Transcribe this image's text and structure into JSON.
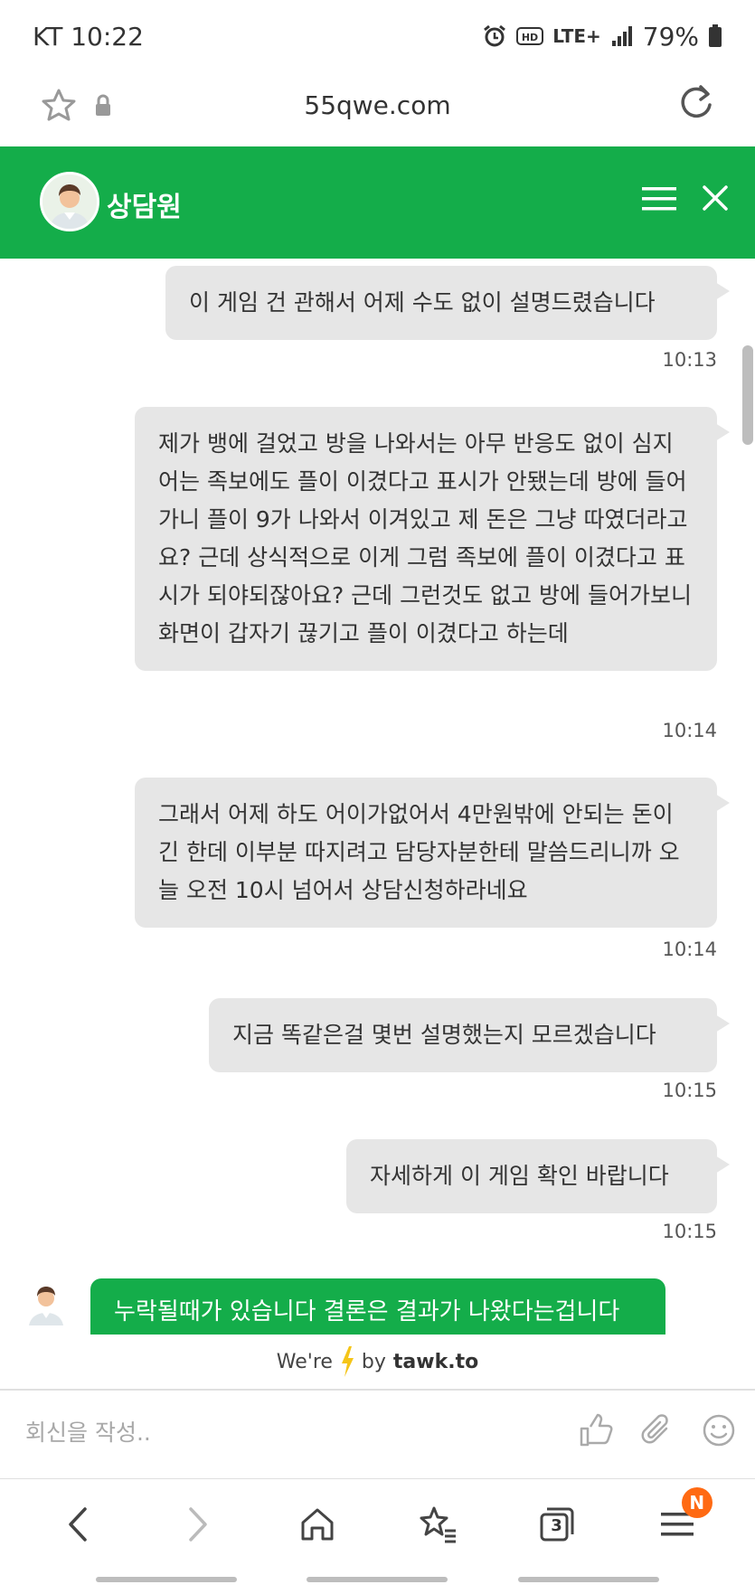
{
  "status": {
    "carrier_time": "KT 10:22",
    "network": "LTE+",
    "battery": "79%"
  },
  "browser": {
    "url": "55qwe.com"
  },
  "chat": {
    "agent_name": "상담원",
    "messages": [
      {
        "text": "이 게임 건 관해서 어제 수도 없이 설명드렸습니다",
        "time": "10:13"
      },
      {
        "text": "제가 뱅에 걸었고 방을 나와서는 아무 반응도 없이 심지어는 족보에도 플이 이겼다고 표시가 안됐는데 방에 들어가니 플이 9가 나와서 이겨있고 제 돈은 그냥 따였더라고요? 근데 상식적으로 이게 그럼 족보에 플이 이겼다고 표시가 되야되잖아요? 근데 그런것도 없고 방에 들어가보니 화면이 갑자기 끊기고 플이 이겼다고 하는데",
        "time": "10:14"
      },
      {
        "text": "그래서 어제 하도 어이가없어서 4만원밖에 안되는 돈이긴 한데 이부분 따지려고 담당자분한테 말씀드리니까 오늘 오전 10시 넘어서 상담신청하라네요",
        "time": "10:14"
      },
      {
        "text": "지금 똑같은걸 몇번 설명했는지 모르겠습니다",
        "time": "10:15"
      },
      {
        "text": "자세하게 이 게임 확인 바랍니다",
        "time": "10:15"
      }
    ],
    "agent_message": "누락될때가 있습니다 결론은 결과가 나왔다는겁니다",
    "powered_prefix": "We're",
    "powered_by": "by",
    "powered_brand": "tawk.to",
    "reply_placeholder": "회신을 작성.."
  },
  "nav": {
    "tab_count": "3",
    "menu_badge": "N"
  },
  "colors": {
    "accent": "#14ad4a",
    "badge": "#ff6a13",
    "bubble": "#e6e6e6"
  }
}
